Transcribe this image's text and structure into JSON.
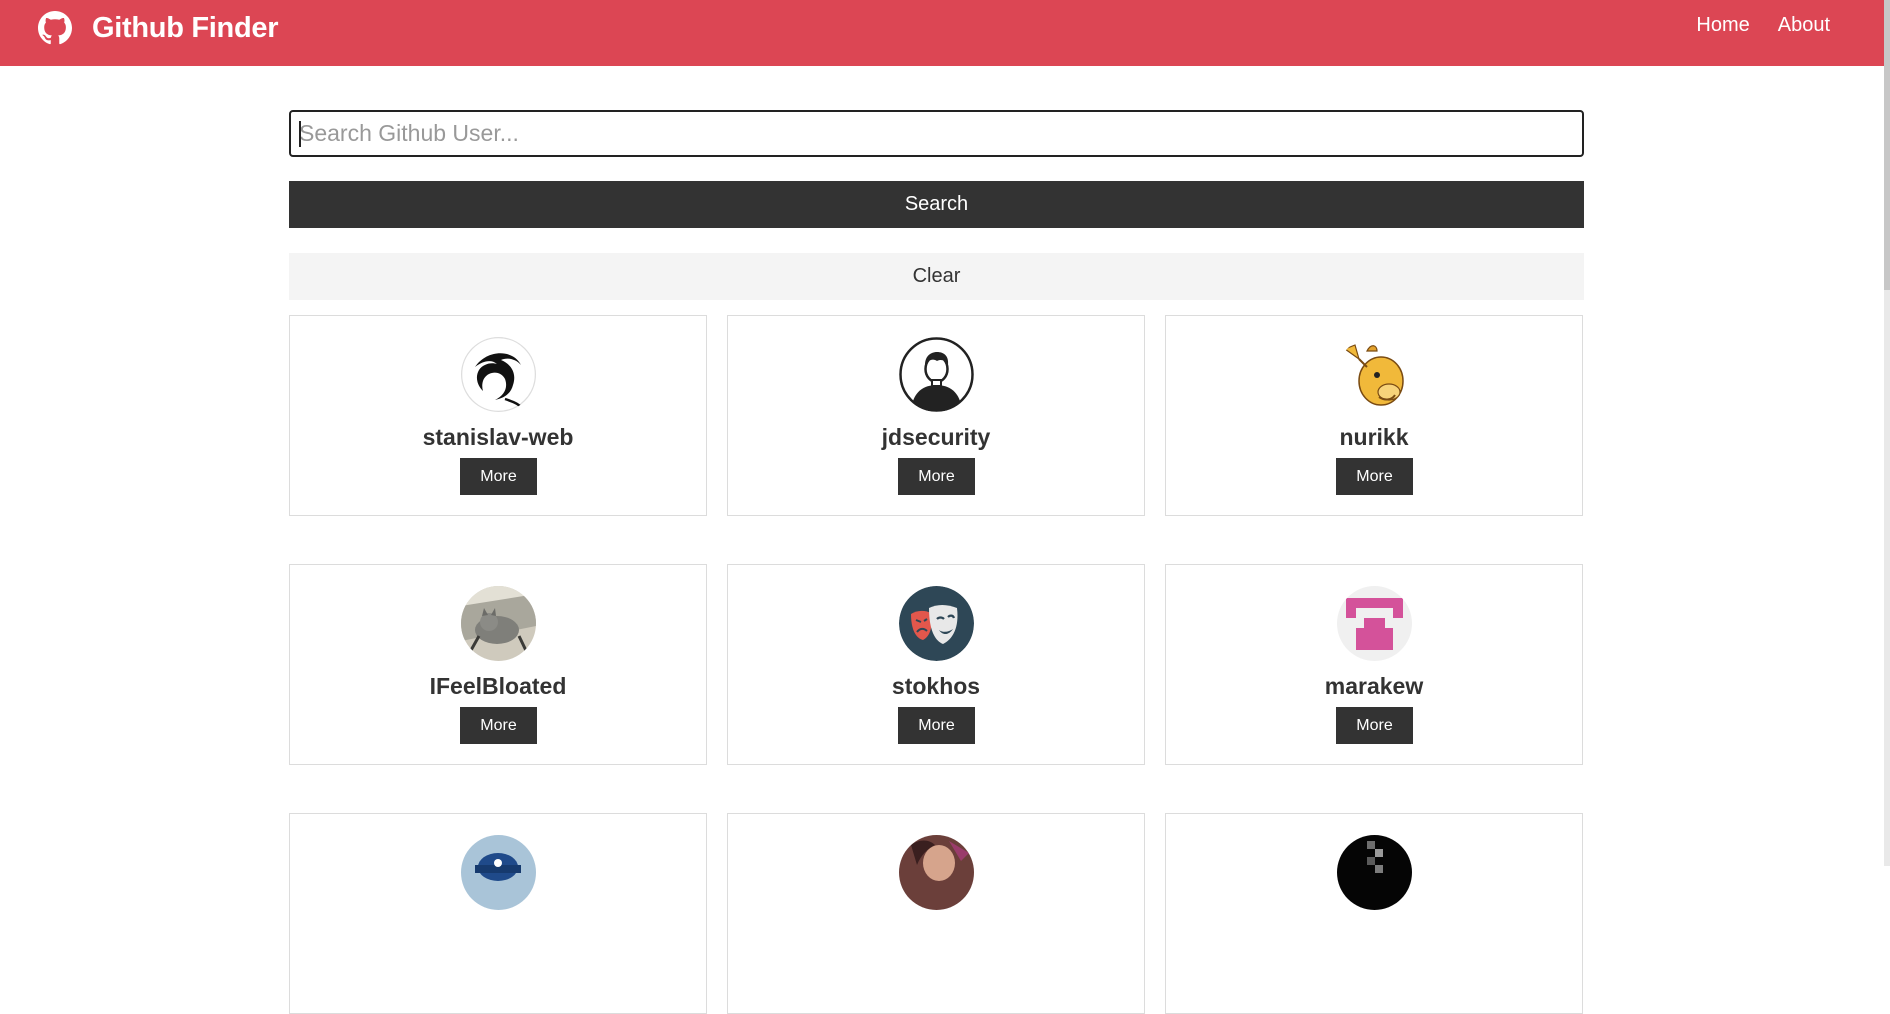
{
  "navbar": {
    "brand_title": "Github Finder",
    "brand_icon": "github-icon",
    "links": [
      {
        "label": "Home"
      },
      {
        "label": "About"
      }
    ],
    "color": "#dc4654"
  },
  "search": {
    "placeholder": "Search Github User...",
    "value": "",
    "search_label": "Search",
    "clear_label": "Clear"
  },
  "users": [
    {
      "login": "stanislav-web",
      "avatar": "kali-dragon-avatar",
      "more_label": "More"
    },
    {
      "login": "jdsecurity",
      "avatar": "person-outline-avatar",
      "more_label": "More"
    },
    {
      "login": "nurikk",
      "avatar": "camel-cartoon-avatar",
      "more_label": "More"
    },
    {
      "login": "IFeelBloated",
      "avatar": "cat-photo-avatar",
      "more_label": "More"
    },
    {
      "login": "stokhos",
      "avatar": "theater-masks-avatar",
      "more_label": "More"
    },
    {
      "login": "marakew",
      "avatar": "pink-identicon-avatar",
      "more_label": "More"
    },
    {
      "login": "",
      "avatar": "blue-hat-avatar",
      "more_label": ""
    },
    {
      "login": "",
      "avatar": "person-photo-avatar",
      "more_label": ""
    },
    {
      "login": "",
      "avatar": "dark-pixel-avatar",
      "more_label": ""
    }
  ]
}
